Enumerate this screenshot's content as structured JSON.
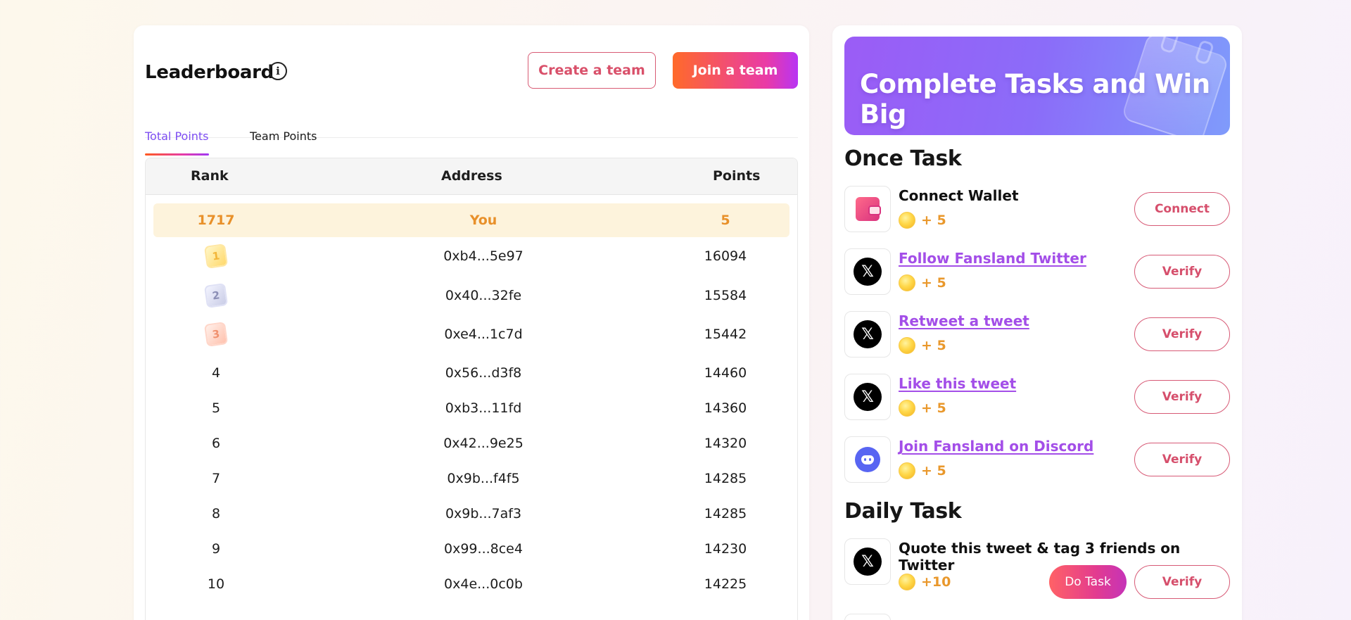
{
  "leaderboard": {
    "title": "Leaderboard",
    "info_icon": "info-icon",
    "create_team_label": "Create a team",
    "join_team_label": "Join a team",
    "tabs": [
      {
        "label": "Total Points",
        "active": true
      },
      {
        "label": "Team Points",
        "active": false
      }
    ],
    "columns": {
      "rank": "Rank",
      "address": "Address",
      "points": "Points"
    },
    "you_row": {
      "rank": "1717",
      "address": "You",
      "points": "5"
    },
    "rows": [
      {
        "rank": "1",
        "medal": "gold-medal-icon",
        "address": "0xb4...5e97",
        "points": "16094"
      },
      {
        "rank": "2",
        "medal": "silver-medal-icon",
        "address": "0x40...32fe",
        "points": "15584"
      },
      {
        "rank": "3",
        "medal": "bronze-medal-icon",
        "address": "0xe4...1c7d",
        "points": "15442"
      },
      {
        "rank": "4",
        "address": "0x56...d3f8",
        "points": "14460"
      },
      {
        "rank": "5",
        "address": "0xb3...11fd",
        "points": "14360"
      },
      {
        "rank": "6",
        "address": "0x42...9e25",
        "points": "14320"
      },
      {
        "rank": "7",
        "address": "0x9b...f4f5",
        "points": "14285"
      },
      {
        "rank": "8",
        "address": "0x9b...7af3",
        "points": "14285"
      },
      {
        "rank": "9",
        "address": "0x99...8ce4",
        "points": "14230"
      },
      {
        "rank": "10",
        "address": "0x4e...0c0b",
        "points": "14225"
      }
    ]
  },
  "tasks": {
    "banner_title": "Complete Tasks and Win Big",
    "once_title": "Once Task",
    "daily_title": "Daily Task",
    "once": [
      {
        "name": "Connect Wallet",
        "icon": "wallet-icon",
        "reward": "+ 5",
        "action": "Connect",
        "link": false
      },
      {
        "name": "Follow Fansland Twitter",
        "icon": "x-icon",
        "reward": "+ 5",
        "action": "Verify",
        "link": true
      },
      {
        "name": "Retweet a tweet",
        "icon": "x-icon",
        "reward": "+ 5",
        "action": "Verify",
        "link": true
      },
      {
        "name": "Like this tweet",
        "icon": "x-icon",
        "reward": "+ 5",
        "action": "Verify",
        "link": true
      },
      {
        "name": "Join Fansland on Discord",
        "icon": "discord-icon",
        "reward": "+ 5",
        "action": "Verify",
        "link": true
      }
    ],
    "daily": [
      {
        "name": "Quote this tweet & tag 3 friends on Twitter",
        "icon": "x-icon",
        "reward": "+10",
        "action": "Verify",
        "secondary_action": "Do Task"
      }
    ]
  },
  "colors": {
    "accent_orange": "#e8902a",
    "accent_purple": "#7d4df2",
    "button_pink": "#d64f6c",
    "link_purple": "#a34ee8"
  }
}
